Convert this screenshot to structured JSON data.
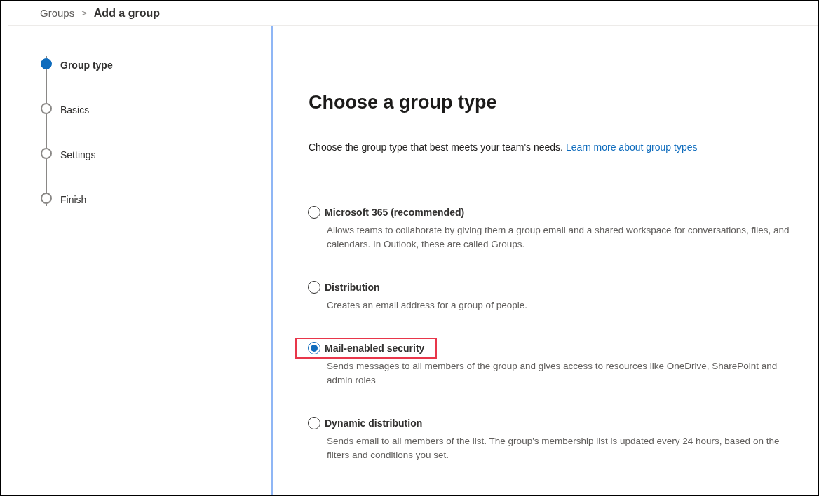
{
  "breadcrumb": {
    "parent": "Groups",
    "separator": ">",
    "current": "Add a group"
  },
  "steps": [
    {
      "label": "Group type",
      "selected": true
    },
    {
      "label": "Basics",
      "selected": false
    },
    {
      "label": "Settings",
      "selected": false
    },
    {
      "label": "Finish",
      "selected": false
    }
  ],
  "heading": "Choose a group type",
  "intro": {
    "text": "Choose the group type that best meets your team's needs.",
    "link": "Learn more about group types"
  },
  "options": [
    {
      "label": "Microsoft 365 (recommended)",
      "description": "Allows teams to collaborate by giving them a group email and a shared workspace for conversations, files, and calendars. In Outlook, these are called Groups.",
      "selected": false,
      "highlighted": false
    },
    {
      "label": "Distribution",
      "description": "Creates an email address for a group of people.",
      "selected": false,
      "highlighted": false
    },
    {
      "label": "Mail-enabled security",
      "description": "Sends messages to all members of the group and gives access to resources like OneDrive, SharePoint and admin roles",
      "selected": true,
      "highlighted": true
    },
    {
      "label": "Dynamic distribution",
      "description": "Sends email to all members of the list. The group's membership list is updated every 24 hours, based on the filters and conditions you set.",
      "selected": false,
      "highlighted": false
    }
  ]
}
